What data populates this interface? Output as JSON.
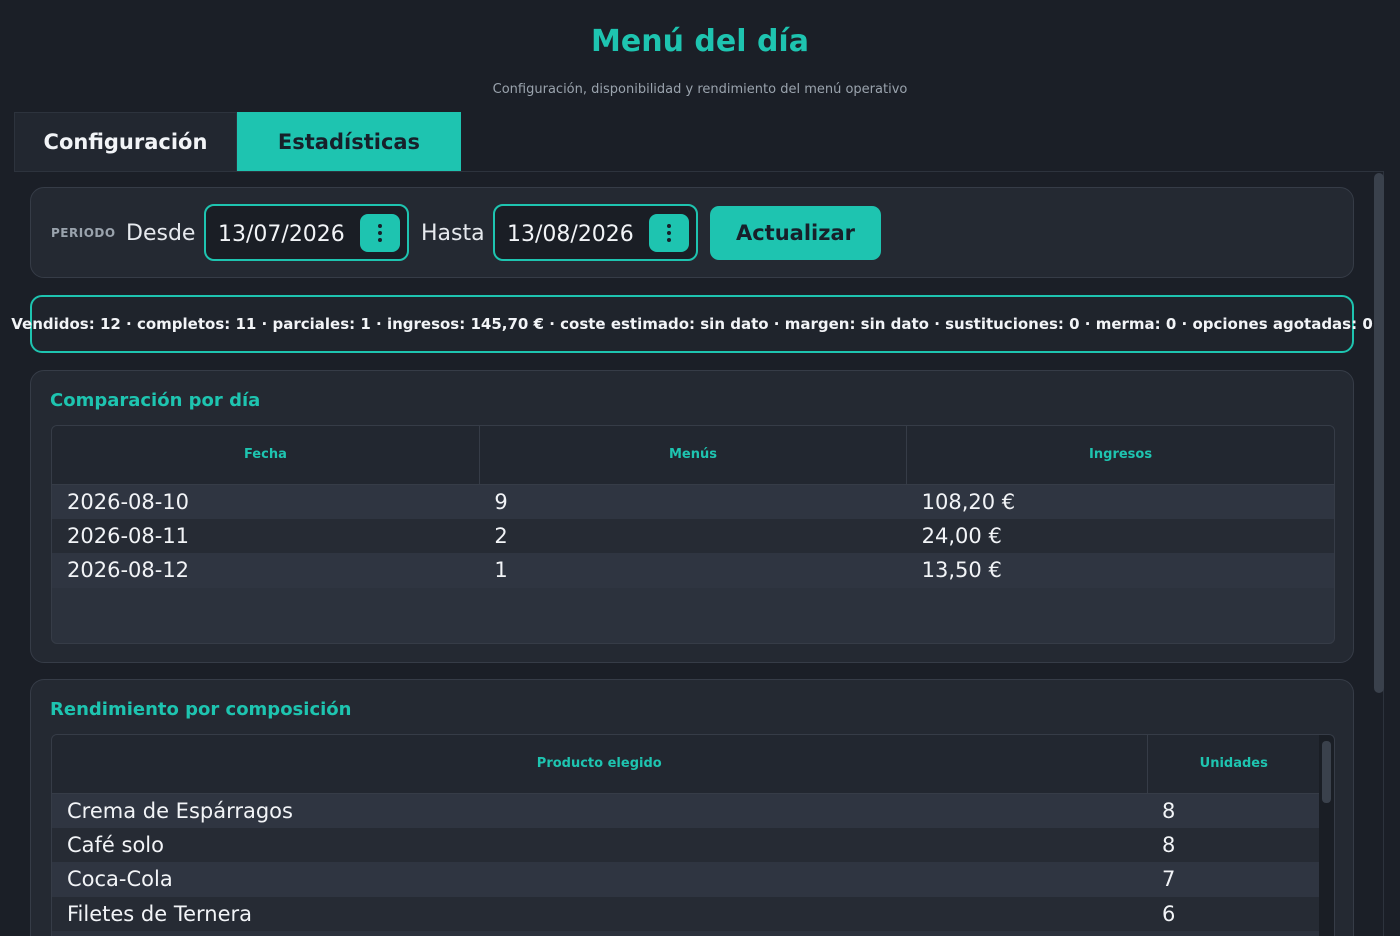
{
  "header": {
    "title": "Menú del día",
    "subtitle": "Configuración, disponibilidad y rendimiento del menú operativo"
  },
  "tabs": [
    {
      "label": "Configuración",
      "active": false
    },
    {
      "label": "Estadísticas",
      "active": true
    }
  ],
  "period": {
    "label": "PERIODO",
    "from_label": "Desde",
    "from_value": "13/07/2026",
    "to_label": "Hasta",
    "to_value": "13/08/2026",
    "update_label": "Actualizar"
  },
  "summary": "Vendidos: 12 · completos: 11 · parciales: 1 · ingresos: 145,70 € · coste estimado: sin dato · margen: sin dato · sustituciones: 0 · merma: 0 · opciones agotadas: 0",
  "comparison": {
    "title": "Comparación por día",
    "columns": [
      "Fecha",
      "Menús",
      "Ingresos"
    ],
    "rows": [
      [
        "2026-08-10",
        "9",
        "108,20 €"
      ],
      [
        "2026-08-11",
        "2",
        "24,00 €"
      ],
      [
        "2026-08-12",
        "1",
        "13,50 €"
      ]
    ]
  },
  "composition": {
    "title": "Rendimiento por composición",
    "columns": [
      "Producto elegido",
      "Unidades"
    ],
    "rows": [
      [
        "Crema de Espárragos",
        "8"
      ],
      [
        "Café solo",
        "8"
      ],
      [
        "Coca-Cola",
        "7"
      ],
      [
        "Filetes de Ternera",
        "6"
      ]
    ]
  },
  "colors": {
    "accent": "#1ec4b0",
    "background": "#1b1f27",
    "card": "#242932"
  },
  "icons": {
    "date_picker": "kebab-menu-icon"
  }
}
